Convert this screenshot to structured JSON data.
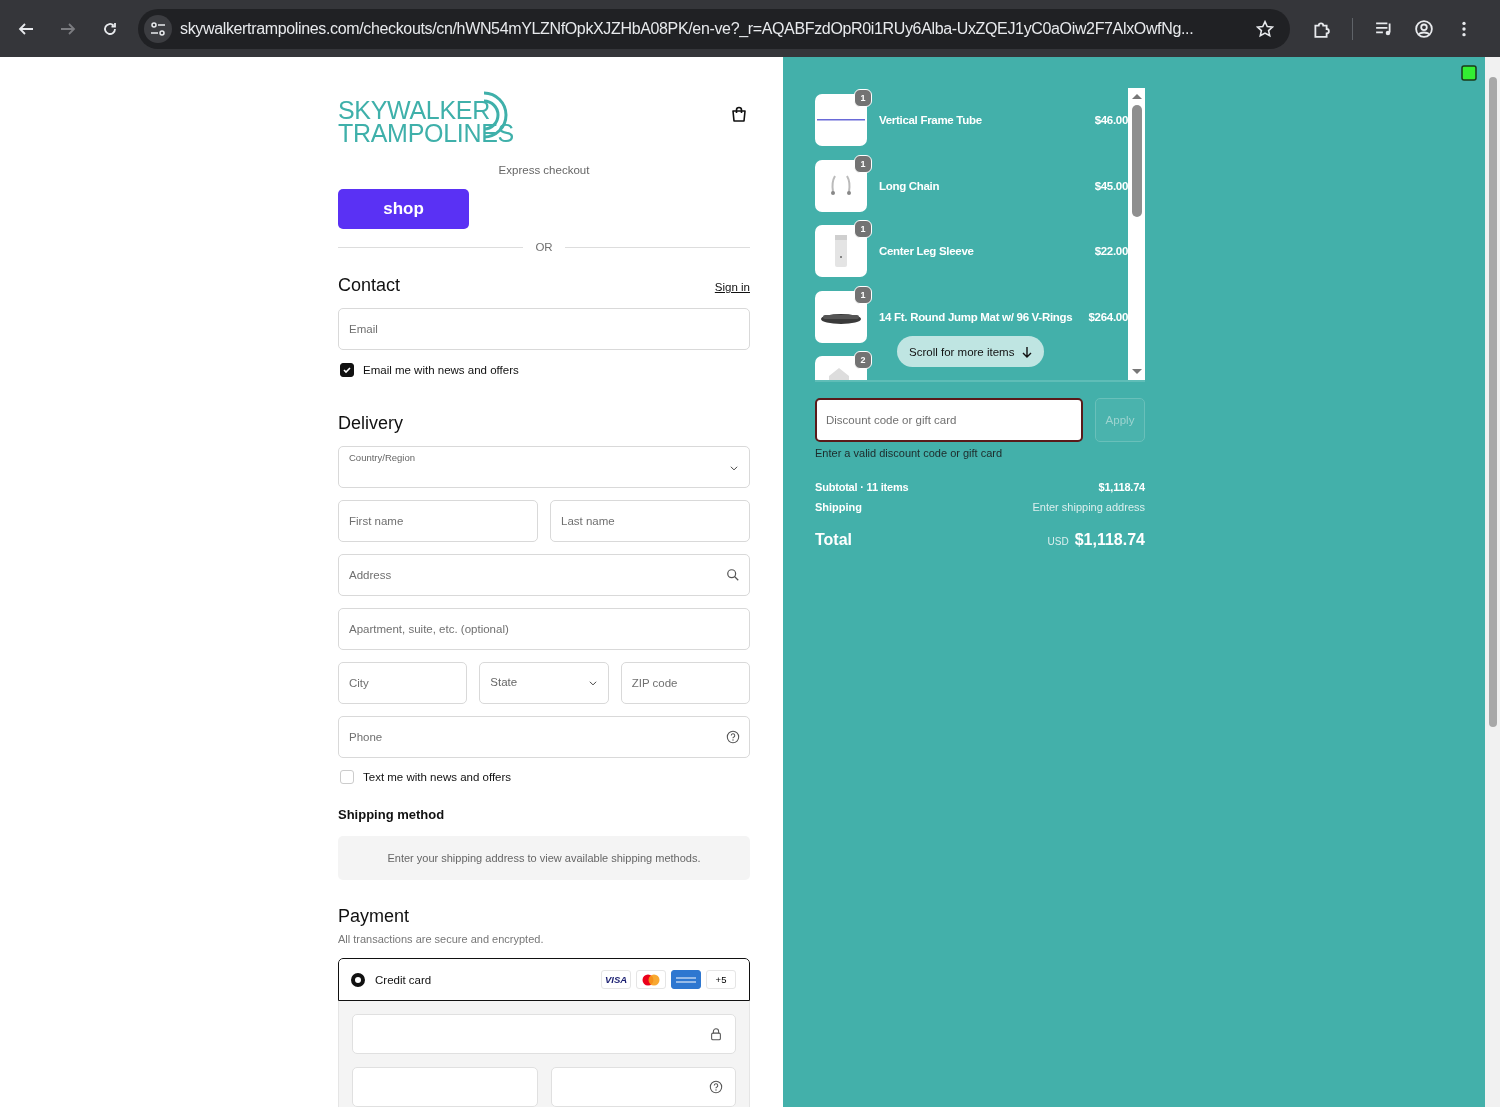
{
  "browser": {
    "url": "skywalkertrampolines.com/checkouts/cn/hWN54mYLZNfOpkXJZHbA08PK/en-ve?_r=AQABFzdOpR0i1RUy6Alba-UxZQEJ1yC0aOiw2F7AlxOwfNg...",
    "forward_disabled": true
  },
  "header": {
    "logo_lines": [
      "SKYWALKER",
      "TRAMPOLINES"
    ],
    "express_label": "Express checkout",
    "shop_button": "shop",
    "divider": "OR"
  },
  "contact": {
    "title": "Contact",
    "sign_in": "Sign in",
    "email_placeholder": "Email",
    "news_checkbox": {
      "label": "Email me with news and offers",
      "checked": true
    }
  },
  "delivery": {
    "title": "Delivery",
    "rows": [
      [
        {
          "kind": "select",
          "label": "Country/Region",
          "floating": true
        }
      ],
      [
        {
          "kind": "text",
          "placeholder": "First name"
        },
        {
          "kind": "text",
          "placeholder": "Last name"
        }
      ],
      [
        {
          "kind": "search",
          "placeholder": "Address"
        }
      ],
      [
        {
          "kind": "text",
          "placeholder": "Apartment, suite, etc. (optional)"
        }
      ],
      [
        {
          "kind": "text",
          "placeholder": "City"
        },
        {
          "kind": "select",
          "label": "State",
          "floating": false
        },
        {
          "kind": "text",
          "placeholder": "ZIP code"
        }
      ],
      [
        {
          "kind": "help",
          "placeholder": "Phone"
        }
      ]
    ],
    "text_checkbox": {
      "label": "Text me with news and offers",
      "checked": false
    }
  },
  "shipping_method": {
    "title": "Shipping method",
    "notice": "Enter your shipping address to view available shipping methods."
  },
  "payment": {
    "title": "Payment",
    "subtitle": "All transactions are secure and encrypted.",
    "methods": [
      {
        "label": "Credit card",
        "selected": true,
        "cards": [
          {
            "kind": "visa",
            "text": "VISA"
          },
          {
            "kind": "mastercard"
          },
          {
            "kind": "amex"
          },
          {
            "kind": "more",
            "text": "+5"
          }
        ]
      }
    ],
    "card_fields": [
      {
        "kind": "lock"
      },
      {
        "kind": "plain"
      },
      {
        "kind": "help"
      }
    ]
  },
  "summary": {
    "items": [
      {
        "name": "Vertical Frame Tube",
        "price": "$46.00",
        "quantity": "1",
        "kind": "tube"
      },
      {
        "name": "Long Chain",
        "price": "$45.00",
        "quantity": "1",
        "kind": "chain"
      },
      {
        "name": "Center Leg Sleeve",
        "price": "$22.00",
        "quantity": "1",
        "kind": "sleeve"
      },
      {
        "name": "14 Ft. Round Jump Mat w/ 96 V-Rings",
        "price": "$264.00",
        "quantity": "1",
        "kind": "mat"
      },
      {
        "quantity": "2",
        "kind": "placeholder"
      }
    ],
    "scroll_hint": "Scroll for more items",
    "discount": {
      "placeholder": "Discount code or gift card",
      "invalid": true,
      "error": "Enter a valid discount code or gift card"
    },
    "apply_button": {
      "label": "Apply",
      "disabled": true
    },
    "subtotal": {
      "label": "Subtotal · 11 items",
      "value": "$1,118.74"
    },
    "shipping": {
      "label": "Shipping",
      "value": "Enter shipping address"
    },
    "total": {
      "label": "Total",
      "currency": "USD",
      "value": "$1,118.74"
    }
  }
}
